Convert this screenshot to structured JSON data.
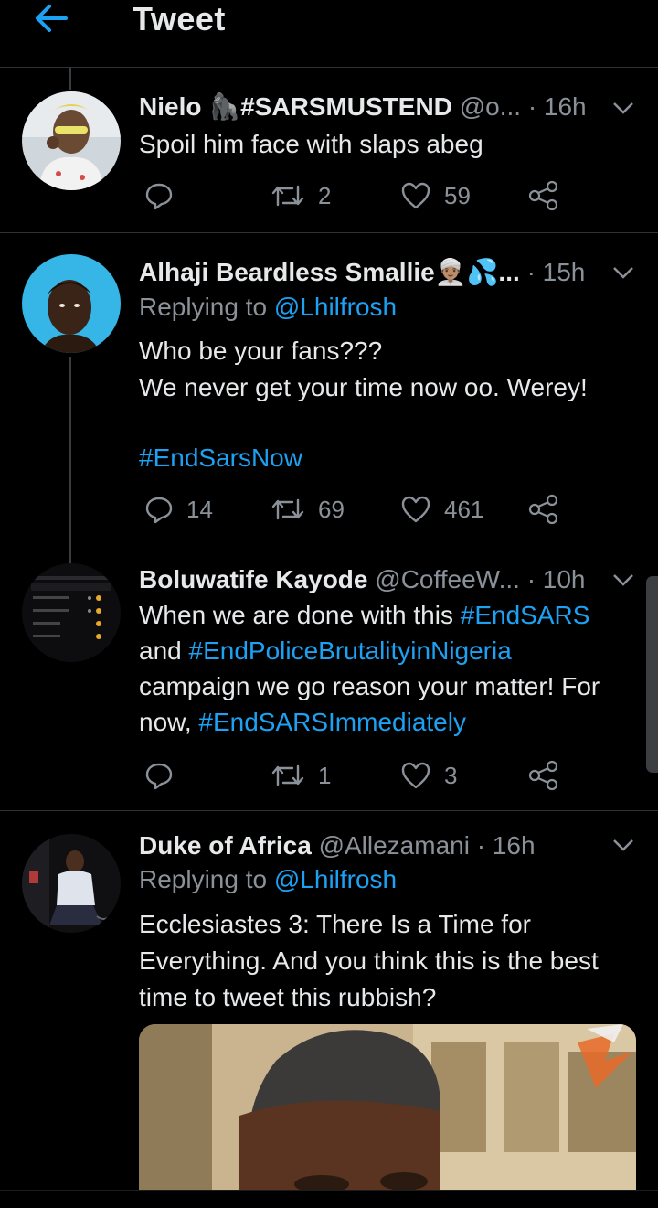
{
  "header": {
    "title": "Tweet"
  },
  "colors": {
    "background": "#000000",
    "accent": "#1da1f2",
    "secondary_text": "#8a9199",
    "divider": "#2f3336"
  },
  "tweets": [
    {
      "name": "Nielo 🦍#SARSMUSTEND",
      "handle": "@o...",
      "time": "· 16h",
      "text_lines": [
        "Spoil him face with slaps abeg"
      ],
      "counts": {
        "reply": "",
        "retweet": "2",
        "like": "59"
      }
    },
    {
      "name": "Alhaji Beardless Smallie👳🏽‍♂️💦...",
      "handle": "",
      "time": "· 15h",
      "replying_prefix": "Replying to",
      "replying_to": "@Lhilfrosh",
      "text_lines": [
        "Who be your fans???",
        "We never get your time now oo. Werey!"
      ],
      "hashtag": "#EndSarsNow",
      "counts": {
        "reply": "14",
        "retweet": "69",
        "like": "461"
      }
    },
    {
      "name": "Boluwatife Kayode",
      "handle": "@CoffeeW...",
      "time": "· 10h",
      "text_lines": [
        {
          "plain": "When we are done with this ",
          "tag": "#EndSARS"
        },
        {
          "plain": "and ",
          "tag": "#EndPoliceBrutalityinNigeria"
        },
        {
          "plain": "campaign we go reason your matter! For",
          "tag": ""
        },
        {
          "plain": "now, ",
          "tag": "#EndSARSImmediately"
        }
      ],
      "counts": {
        "reply": "",
        "retweet": "1",
        "like": "3"
      }
    },
    {
      "name": "Duke of Africa",
      "handle": "@Allezamani",
      "time": "· 16h",
      "replying_prefix": "Replying to",
      "replying_to": "@Lhilfrosh",
      "text_lines": [
        "Ecclesiastes 3: There Is a Time for",
        "Everything. And you think this is the best",
        "time to tweet this rubbish?"
      ]
    }
  ]
}
